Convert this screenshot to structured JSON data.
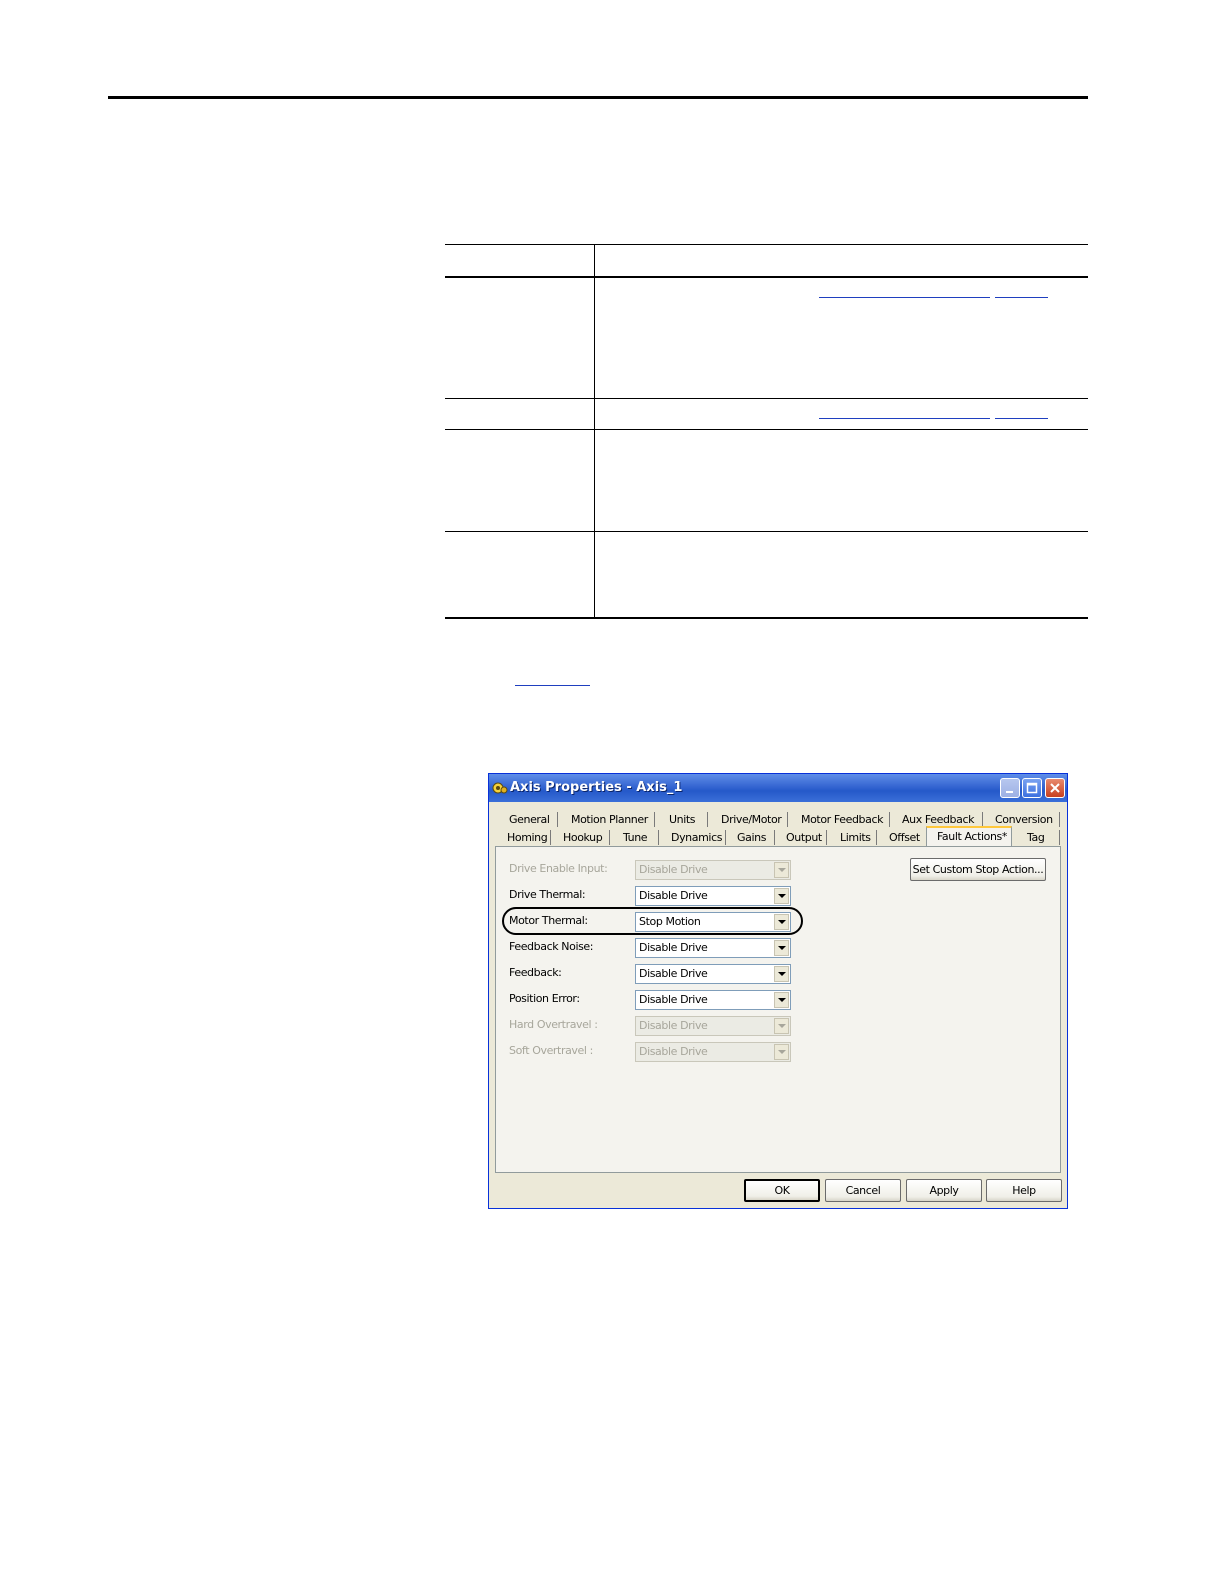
{
  "dialog": {
    "title": "Axis Properties - Axis_1",
    "tabs_row1": [
      "General",
      "Motion Planner",
      "Units",
      "Drive/Motor",
      "Motor Feedback",
      "Aux Feedback",
      "Conversion"
    ],
    "tabs_row2": [
      "Homing",
      "Hookup",
      "Tune",
      "Dynamics",
      "Gains",
      "Output",
      "Limits",
      "Offset",
      "Fault Actions*",
      "Tag"
    ],
    "active_tab": "Fault Actions*",
    "rows": [
      {
        "label": "Drive Enable Input:",
        "value": "Disable Drive",
        "enabled": false
      },
      {
        "label": "Drive Thermal:",
        "value": "Disable Drive",
        "enabled": true
      },
      {
        "label": "Motor Thermal:",
        "value": "Stop Motion",
        "enabled": true
      },
      {
        "label": "Feedback Noise:",
        "value": "Disable Drive",
        "enabled": true
      },
      {
        "label": "Feedback:",
        "value": "Disable Drive",
        "enabled": true
      },
      {
        "label": "Position Error:",
        "value": "Disable Drive",
        "enabled": true
      },
      {
        "label": "Hard Overtravel :",
        "value": "Disable Drive",
        "enabled": false
      },
      {
        "label": "Soft Overtravel :",
        "value": "Disable Drive",
        "enabled": false
      }
    ],
    "custom_stop_button": "Set Custom Stop Action...",
    "buttons": {
      "ok": "OK",
      "cancel": "Cancel",
      "apply": "Apply",
      "help": "Help"
    }
  },
  "colors": {
    "title_bar": "#2559c9",
    "dialog_bg": "#ece9d8",
    "link": "#1f3fbf"
  }
}
